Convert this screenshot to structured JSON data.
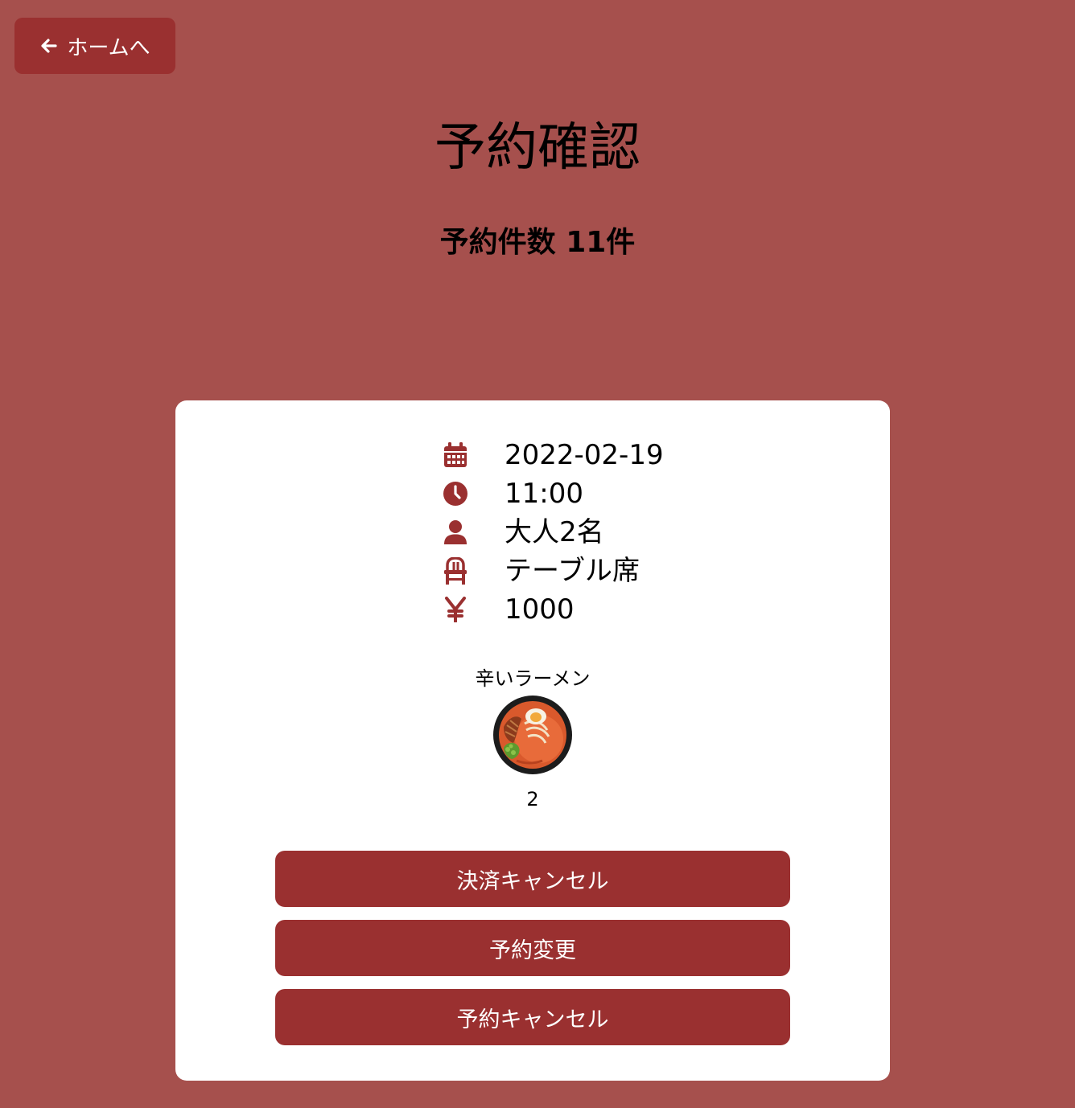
{
  "header": {
    "home_label": "ホームへ",
    "title": "予約確認",
    "reservation_count": "予約件数 11件"
  },
  "reservation": {
    "date": "2022-02-19",
    "time": "11:00",
    "people": "大人2名",
    "seat": "テーブル席",
    "price": "1000",
    "icons": [
      "calendar-icon",
      "clock-icon",
      "user-icon",
      "chair-icon",
      "yen-icon"
    ],
    "dish": {
      "name": "辛いラーメン",
      "quantity": "2"
    }
  },
  "actions": {
    "payment_cancel": "決済キャンセル",
    "change": "予約変更",
    "cancel": "予約キャンセル"
  },
  "colors": {
    "background": "#a6504d",
    "accent": "#9a3030",
    "card": "#ffffff"
  }
}
